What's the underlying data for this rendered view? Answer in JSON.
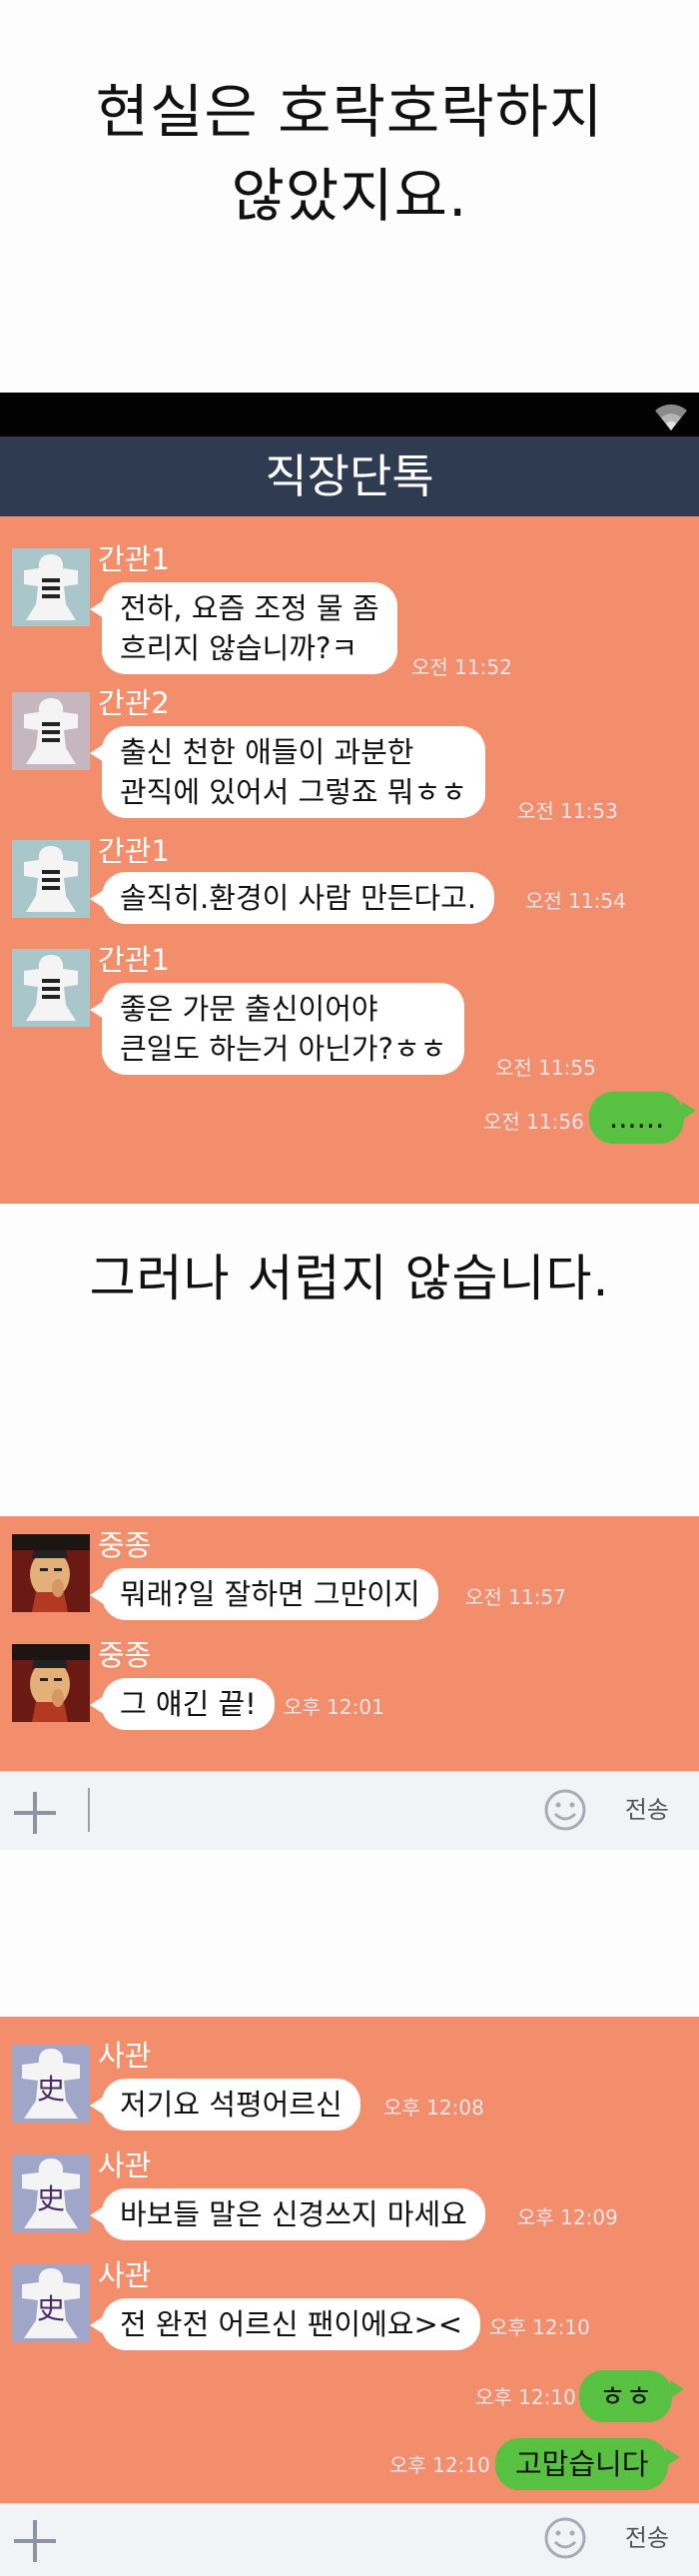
{
  "captions": {
    "top_line1": "현실은 호락호락하지",
    "top_line2": "않았지요.",
    "middle": "그러나 서럽지 않습니다."
  },
  "chat_title": "직장단톡",
  "section1": {
    "messages": [
      {
        "sender": "간관1",
        "line1": "전하, 요즘 조정 물 좀",
        "line2": "흐리지 않습니까?ㅋ",
        "time": "오전 11:52"
      },
      {
        "sender": "간관2",
        "line1": "출신 천한 애들이 과분한",
        "line2": "관직에 있어서 그렇죠 뭐ㅎㅎ",
        "time": "오전 11:53"
      },
      {
        "sender": "간관1",
        "line1": "솔직히.환경이 사람 만든다고.",
        "time": "오전 11:54"
      },
      {
        "sender": "간관1",
        "line1": "좋은 가문 출신이어야",
        "line2": "큰일도 하는거 아닌가?ㅎㅎ",
        "time": "오전 11:55"
      }
    ],
    "mine": {
      "text": "......",
      "time": "오전 11:56"
    }
  },
  "section2": {
    "messages": [
      {
        "sender": "중종",
        "text": "뭐래?일 잘하면 그만이지",
        "time": "오전 11:57"
      },
      {
        "sender": "중종",
        "text": "그 얘긴 끝!",
        "time": "오후 12:01"
      }
    ]
  },
  "section3": {
    "messages": [
      {
        "sender": "사관",
        "text": "저기요 석평어르신",
        "time": "오후 12:08"
      },
      {
        "sender": "사관",
        "text": "바보들 말은 신경쓰지 마세요",
        "time": "오후 12:09"
      },
      {
        "sender": "사관",
        "text": "전 완전 어르신 팬이에요><",
        "time": "오후 12:10"
      }
    ],
    "mine": [
      {
        "text": "ㅎㅎ",
        "time": "오후 12:10"
      },
      {
        "text": "고맙습니다",
        "time": "오후 12:10"
      }
    ]
  },
  "input_bar": {
    "send_label": "전송"
  },
  "avatar_glyph_scribe": "史",
  "colors": {
    "chat_background": "#f38e6c",
    "title_bar": "#2e3b50",
    "my_bubble": "#58c141",
    "their_bubble": "#ffffff"
  }
}
